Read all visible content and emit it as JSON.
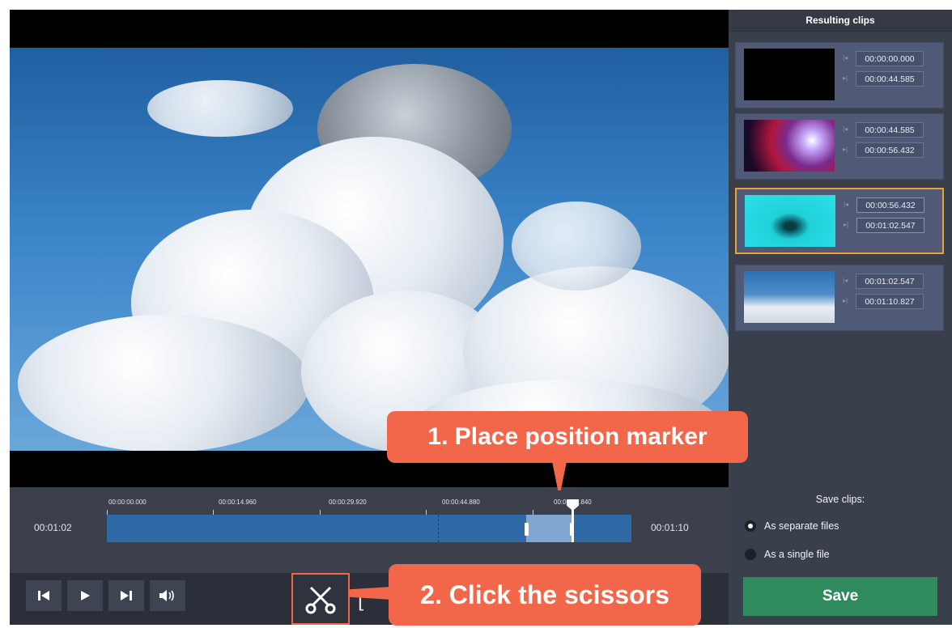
{
  "panel": {
    "title": "Resulting clips",
    "clips": [
      {
        "start": "00:00:00.000",
        "end": "00:00:44.585",
        "thumb": "black",
        "selected": false
      },
      {
        "start": "00:00:44.585",
        "end": "00:00:56.432",
        "thumb": "galaxy",
        "selected": false
      },
      {
        "start": "00:00:56.432",
        "end": "00:01:02.547",
        "thumb": "water-drop",
        "selected": true
      },
      {
        "start": "00:01:02.547",
        "end": "00:01:10.827",
        "thumb": "clouds",
        "selected": false
      }
    ]
  },
  "timeline": {
    "current_time": "00:01:02",
    "total_time": "00:01:10",
    "ruler_labels": [
      "00:00:00.000",
      "00:00:14.960",
      "00:00:29.920",
      "00:00:44.880",
      "00:00:59.840"
    ]
  },
  "save": {
    "title": "Save clips:",
    "option_separate": "As separate files",
    "option_single": "As a single file",
    "selected_option": "As separate files",
    "button_label": "Save"
  },
  "callouts": {
    "step1": "1. Place position marker",
    "step2": "2. Click the scissors"
  },
  "controls": {
    "icons": [
      "skip-back-icon",
      "play-icon",
      "skip-forward-icon",
      "volume-icon",
      "scissors-icon",
      "bracket-icon"
    ]
  },
  "colors": {
    "accent_orange": "#f2674a",
    "save_green": "#2f8b5e",
    "selected_border": "#e8a33b",
    "track_blue": "#2f6aa6"
  }
}
